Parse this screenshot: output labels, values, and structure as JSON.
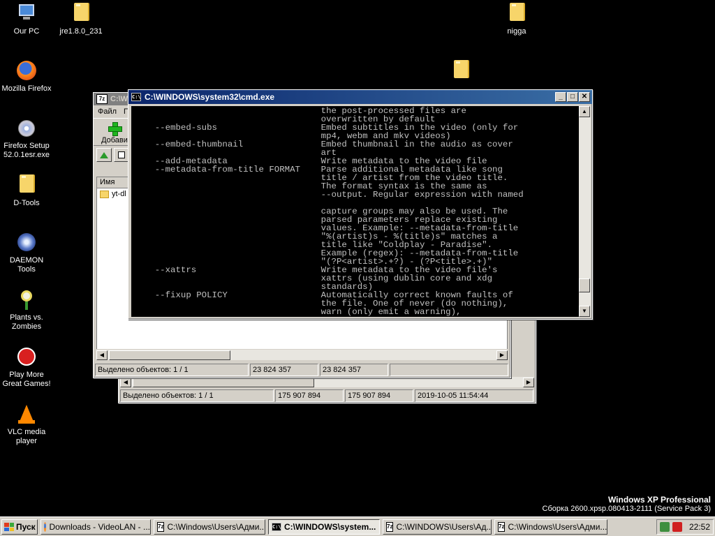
{
  "desktop": {
    "icons": [
      {
        "label": "Our PC"
      },
      {
        "label": "jre1.8.0_231"
      },
      {
        "label": "nigga"
      },
      {
        "label": "Mozilla Firefox"
      },
      {
        "label": "Firefox Setup 52.0.1esr.exe"
      },
      {
        "label": "D-Tools"
      },
      {
        "label": "DAEMON Tools"
      },
      {
        "label": "Plants vs. Zombies"
      },
      {
        "label": "Play More Great Games!"
      },
      {
        "label": "VLC media player"
      }
    ],
    "winver_line1": "Windows XP Professional",
    "winver_line2": "Сборка 2600.xpsp.080413-2111 (Service Pack 3)"
  },
  "window_7z_back": {
    "status": [
      "Выделено объектов: 1 / 1",
      "175 907 894",
      "175 907 894",
      "2019-10-05 11:54:44"
    ]
  },
  "window_7z_front": {
    "title": "C:\\W",
    "menu": [
      "Файл",
      "П"
    ],
    "add_label": "Добави",
    "column_name": "Имя",
    "file_item": "yt-dl",
    "status": [
      "Выделено объектов: 1 / 1",
      "23 824 357",
      "23 824 357",
      ""
    ]
  },
  "cmd": {
    "title": "C:\\WINDOWS\\system32\\cmd.exe",
    "icon_text": "C:\\",
    "lines": [
      "                                    the post-processed files are",
      "                                    overwritten by default",
      "    --embed-subs                    Embed subtitles in the video (only for",
      "                                    mp4, webm and mkv videos)",
      "    --embed-thumbnail               Embed thumbnail in the audio as cover",
      "                                    art",
      "    --add-metadata                  Write metadata to the video file",
      "    --metadata-from-title FORMAT    Parse additional metadata like song",
      "                                    title / artist from the video title.",
      "                                    The format syntax is the same as",
      "                                    --output. Regular expression with named",
      "",
      "                                    capture groups may also be used. The",
      "                                    parsed parameters replace existing",
      "                                    values. Example: --metadata-from-title",
      "                                    \"%(artist)s - %(title)s\" matches a",
      "                                    title like \"Coldplay - Paradise\".",
      "                                    Example (regex): --metadata-from-title",
      "                                    \"(?P<artist>.+?) - (?P<title>.+)\"",
      "    --xattrs                        Write metadata to the video file's",
      "                                    xattrs (using dublin core and xdg",
      "                                    standards)",
      "    --fixup POLICY                  Automatically correct known faults of",
      "                                    the file. One of never (do nothing),",
      "                                    warn (only emit a warning),"
    ]
  },
  "taskbar": {
    "start_label": "Пуск",
    "buttons": [
      {
        "label": "Downloads - VideoLAN - ...",
        "icon": "firefox-icon"
      },
      {
        "label": "C:\\Windows\\Users\\Адми...",
        "icon": "7z-icon"
      },
      {
        "label": "C:\\WINDOWS\\system...",
        "icon": "cmd-icon"
      },
      {
        "label": "C:\\WINDOWS\\Users\\Ад...",
        "icon": "7z-icon"
      },
      {
        "label": "C:\\Windows\\Users\\Адми...",
        "icon": "7z-icon"
      }
    ],
    "clock": "22:52"
  }
}
